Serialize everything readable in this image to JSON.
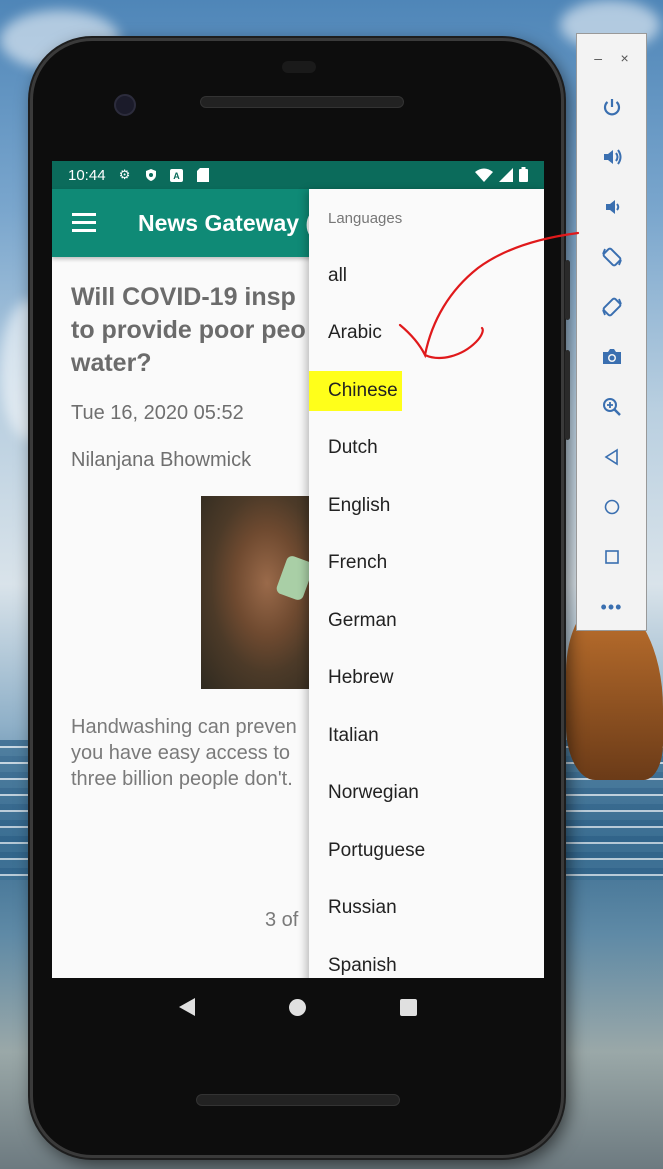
{
  "status_bar": {
    "time": "10:44"
  },
  "app_bar": {
    "title": "News Gateway ("
  },
  "article": {
    "headline": [
      "Will COVID-19 insp",
      "to provide poor peo",
      "water?"
    ],
    "date": "Tue 16, 2020 05:52",
    "author": "Nilanjana Bhowmick",
    "summary": [
      "Handwashing can preven",
      "you have easy access to",
      "three billion people don't."
    ],
    "page_indicator": "3 of"
  },
  "menu": {
    "header": "Languages",
    "items": [
      "all",
      "Arabic",
      "Chinese",
      "Dutch",
      "English",
      "French",
      "German",
      "Hebrew",
      "Italian",
      "Norwegian",
      "Portuguese",
      "Russian",
      "Spanish"
    ],
    "highlighted": "Chinese",
    "highlight_color": "#ffff1a"
  },
  "emulator_toolbar": {
    "minimize": "–",
    "close": "×",
    "buttons": [
      "power-icon",
      "volume-up-icon",
      "volume-down-icon",
      "rotate-left-icon",
      "rotate-right-icon",
      "camera-icon",
      "zoom-icon",
      "back-icon",
      "home-icon",
      "overview-icon",
      "more-icon"
    ],
    "more_label": "•••"
  },
  "colors": {
    "status_bar": "#0b6b5b",
    "app_bar": "#0f8a76",
    "toolbar_icon": "#3a6fb0",
    "annotation": "#e0191b"
  }
}
